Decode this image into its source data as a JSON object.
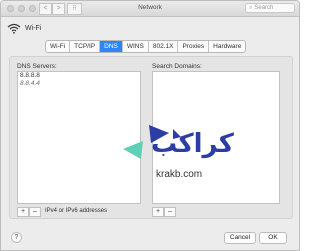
{
  "window": {
    "title": "Network",
    "search_placeholder": "Search",
    "nav_back": "<",
    "nav_forward": ">",
    "grid_glyph": "⠿"
  },
  "network": {
    "name": "Wi-Fi",
    "icon": "wifi-icon"
  },
  "tabs": [
    {
      "label": "Wi-Fi",
      "active": false
    },
    {
      "label": "TCP/IP",
      "active": false
    },
    {
      "label": "DNS",
      "active": true
    },
    {
      "label": "WINS",
      "active": false
    },
    {
      "label": "802.1X",
      "active": false
    },
    {
      "label": "Proxies",
      "active": false
    },
    {
      "label": "Hardware",
      "active": false
    }
  ],
  "dns": {
    "label": "DNS Servers:",
    "servers": [
      "8.8.8.8",
      "8.8.4.4"
    ],
    "hint": "IPv4 or IPv6 addresses"
  },
  "search_domains": {
    "label": "Search Domains:",
    "entries": []
  },
  "controls": {
    "add": "+",
    "remove": "–",
    "help": "?",
    "cancel": "Cancel",
    "ok": "OK"
  },
  "watermark": {
    "text": "كراكب",
    "url": "krakb.com"
  },
  "colors": {
    "accent": "#2f86f2",
    "watermark_blue": "#2c3ea6",
    "watermark_teal": "#5fcfb7"
  }
}
